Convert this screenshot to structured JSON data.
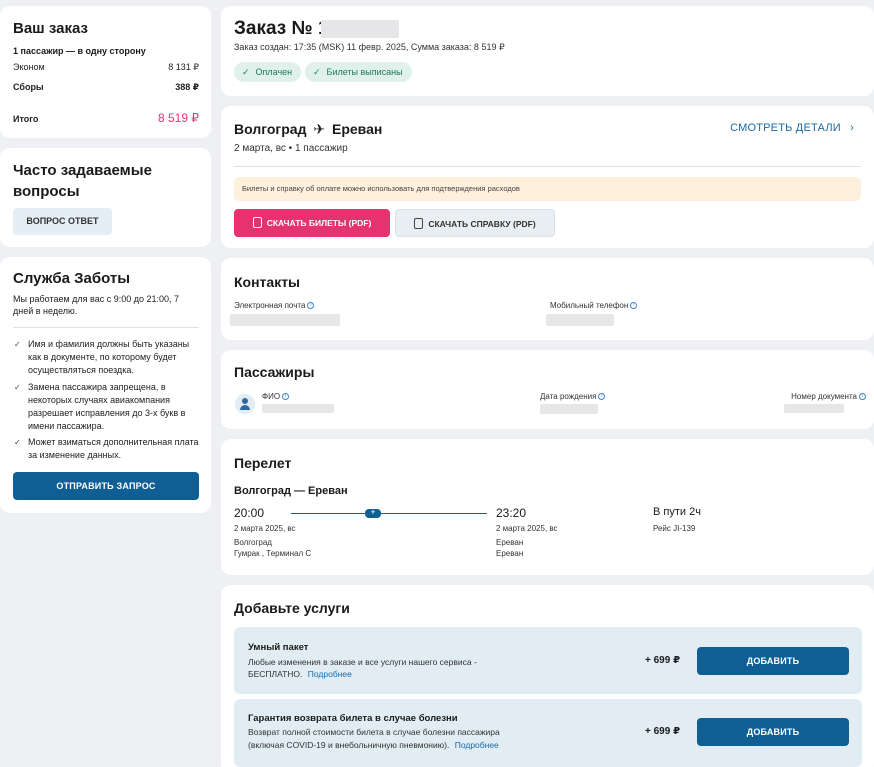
{
  "summary": {
    "title": "Ваш заказ",
    "trip": "1 пассажир — в одну сторону",
    "rows": [
      {
        "label": "Эконом",
        "value": "8 131 ₽"
      },
      {
        "label": "Сборы",
        "value": "388 ₽"
      }
    ],
    "total_label": "Итого",
    "total_value": "8 519 ₽"
  },
  "faq": {
    "title": "Часто задаваемые вопросы",
    "button": "ВОПРОС ОТВЕТ"
  },
  "support": {
    "title": "Служба Заботы",
    "hours": "Мы работаем для вас с 9:00 до 21:00, 7 дней в неделю.",
    "notes": [
      "Имя и фамилия должны быть указаны как в документе, по которому будет осуществляться поездка.",
      "Замена пассажира запрещена, в некоторых случаях авиакомпания разрешает исправления до 3-х букв в имени пассажира.",
      "Может взиматься дополнительная плата за изменение данных."
    ],
    "button": "ОТПРАВИТЬ ЗАПРОС"
  },
  "order": {
    "title": "Заказ № 1",
    "meta": "Заказ создан: 17:35 (MSK) 11 февр. 2025, Сумма заказа: 8 519 ₽",
    "badges": [
      "Оплачен",
      "Билеты выписаны"
    ]
  },
  "route": {
    "from": "Волгоград",
    "to": "Ереван",
    "details_link": "СМОТРЕТЬ ДЕТАЛИ",
    "subtitle": "2 марта, вс",
    "passengers": "1 пассажир",
    "notice": "Билеты и справку об оплате можно использовать для подтверждения расходов",
    "btn_tickets": "СКАЧАТЬ БИЛЕТЫ (PDF)",
    "btn_receipt": "СКАЧАТЬ СПРАВКУ (PDF)"
  },
  "contacts": {
    "title": "Контакты",
    "email_label": "Электронная почта",
    "phone_label": "Мобильный телефон"
  },
  "passengers": {
    "title": "Пассажиры",
    "name_label": "ФИО",
    "dob_label": "Дата рождения",
    "doc_label": "Номер документа"
  },
  "flight": {
    "title": "Перелет",
    "route": "Волгоград — Ереван",
    "dep_time": "20:00",
    "dep_date": "2 марта 2025, вс",
    "dep_city": "Волгоград",
    "dep_airport": "Гумрак , Терминал C",
    "arr_time": "23:20",
    "arr_date": "2 марта 2025, вс",
    "arr_city": "Ереван",
    "arr_airport": "Ереван",
    "duration": "В пути 2ч",
    "flight_no": "Рейс JI-139"
  },
  "services": {
    "title": "Добавьте услуги",
    "items": [
      {
        "title": "Умный пакет",
        "desc_1": "Любые изменения в заказе и все услуги нашего сервиса -",
        "desc_2": "БЕСПЛАТНО.",
        "more": "Подробнее",
        "price": "+ 699 ₽",
        "button": "ДОБАВИТЬ"
      },
      {
        "title": "Гарантия возврата билета в случае болезни",
        "desc_1": "Возврат полной стоимости билета в случае болезни пассажира",
        "desc_2": "(включая COVID-19 и внебольничную пневмонию).",
        "more": "Подробнее",
        "price": "+ 699 ₽",
        "button": "ДОБАВИТЬ"
      }
    ]
  },
  "colors": {
    "accent_pink": "#e6336f",
    "primary_blue": "#0f5f95",
    "link_blue": "#1a6aa8",
    "paid_green": "#dff1ea",
    "notice_bg": "#fdf0dc",
    "service_bg": "#e1edf3"
  }
}
